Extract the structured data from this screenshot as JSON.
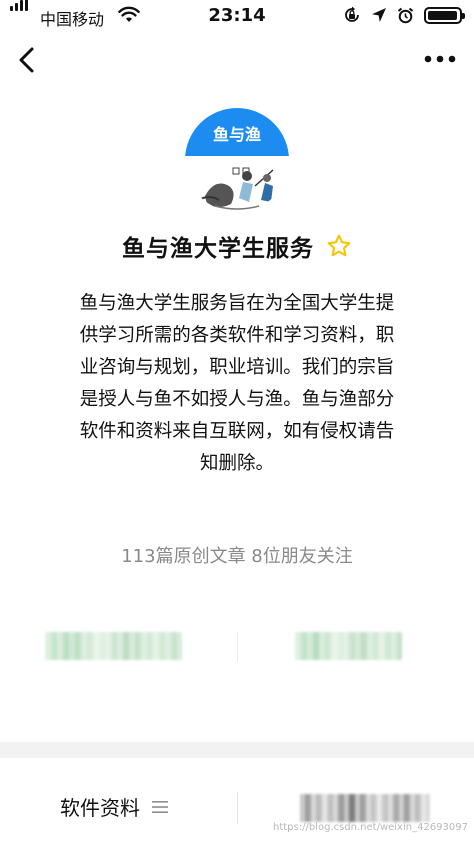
{
  "status_bar": {
    "carrier": "中国移动",
    "time": "23:14"
  },
  "profile": {
    "avatar_text": "鱼与渔",
    "name": "鱼与渔大学生服务",
    "description": "鱼与渔大学生服务旨在为全国大学生提供学习所需的各类软件和学习资料，职业咨询与规划，职业培训。我们的宗旨是授人与鱼不如授人与渔。鱼与渔部分软件和资料来自互联网，如有侵权请告知删除。",
    "stats": "113篇原创文章  8位朋友关注"
  },
  "menu": {
    "left_label": "软件资料"
  },
  "watermark": "https://blog.csdn.net/weixin_42693097",
  "colors": {
    "brand_blue": "#1d8cf0",
    "star_yellow": "#f5c500",
    "muted_text": "#8a8a8a"
  }
}
